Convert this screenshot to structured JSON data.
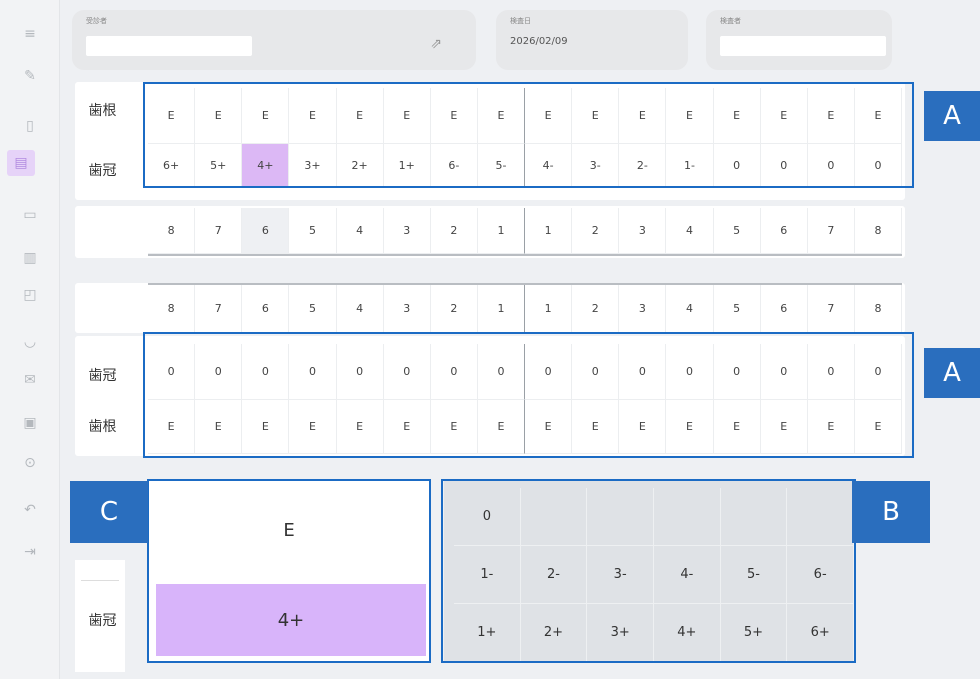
{
  "header": {
    "field1_label": "受診者",
    "field2_label": "検査日",
    "date": "2026/02/09",
    "field3_label": "検査者"
  },
  "upper": {
    "root_label": "歯根",
    "crown_label": "歯冠",
    "root_values": [
      "E",
      "E",
      "E",
      "E",
      "E",
      "E",
      "E",
      "E",
      "E",
      "E",
      "E",
      "E",
      "E",
      "E",
      "E",
      "E"
    ],
    "crown_values": [
      "6+",
      "5+",
      "4+",
      "3+",
      "2+",
      "1+",
      "6-",
      "5-",
      "4-",
      "3-",
      "2-",
      "1-",
      "0",
      "0",
      "0",
      "0"
    ],
    "numbers": [
      "8",
      "7",
      "6",
      "5",
      "4",
      "3",
      "2",
      "1",
      "1",
      "2",
      "3",
      "4",
      "5",
      "6",
      "7",
      "8"
    ]
  },
  "lower": {
    "numbers": [
      "8",
      "7",
      "6",
      "5",
      "4",
      "3",
      "2",
      "1",
      "1",
      "2",
      "3",
      "4",
      "5",
      "6",
      "7",
      "8"
    ],
    "crown_label": "歯冠",
    "root_label": "歯根",
    "crown_values": [
      "0",
      "0",
      "0",
      "0",
      "0",
      "0",
      "0",
      "0",
      "0",
      "0",
      "0",
      "0",
      "0",
      "0",
      "0",
      "0"
    ],
    "root_values": [
      "E",
      "E",
      "E",
      "E",
      "E",
      "E",
      "E",
      "E",
      "E",
      "E",
      "E",
      "E",
      "E",
      "E",
      "E",
      "E"
    ]
  },
  "selection": {
    "root_value": "E",
    "crown_label": "歯冠",
    "crown_value": "4+"
  },
  "keypad": {
    "row1": [
      "0",
      "",
      "",
      "",
      "",
      ""
    ],
    "row2": [
      "1-",
      "2-",
      "3-",
      "4-",
      "5-",
      "6-"
    ],
    "row3": [
      "1+",
      "2+",
      "3+",
      "4+",
      "5+",
      "6+"
    ]
  },
  "callouts": {
    "a1": "A",
    "a2": "A",
    "b": "B",
    "c": "C"
  },
  "colors": {
    "accent": "#1b6bc4",
    "selected": "#dcb8f5"
  },
  "sidebar_icons": [
    "menu-icon",
    "pencil-icon",
    "document-icon",
    "folder-icon",
    "monitor-icon",
    "clipboard-icon",
    "chart-icon",
    "tooth-icon",
    "mail-icon",
    "camera-icon",
    "settings-icon",
    "undo-icon",
    "exit-icon"
  ]
}
